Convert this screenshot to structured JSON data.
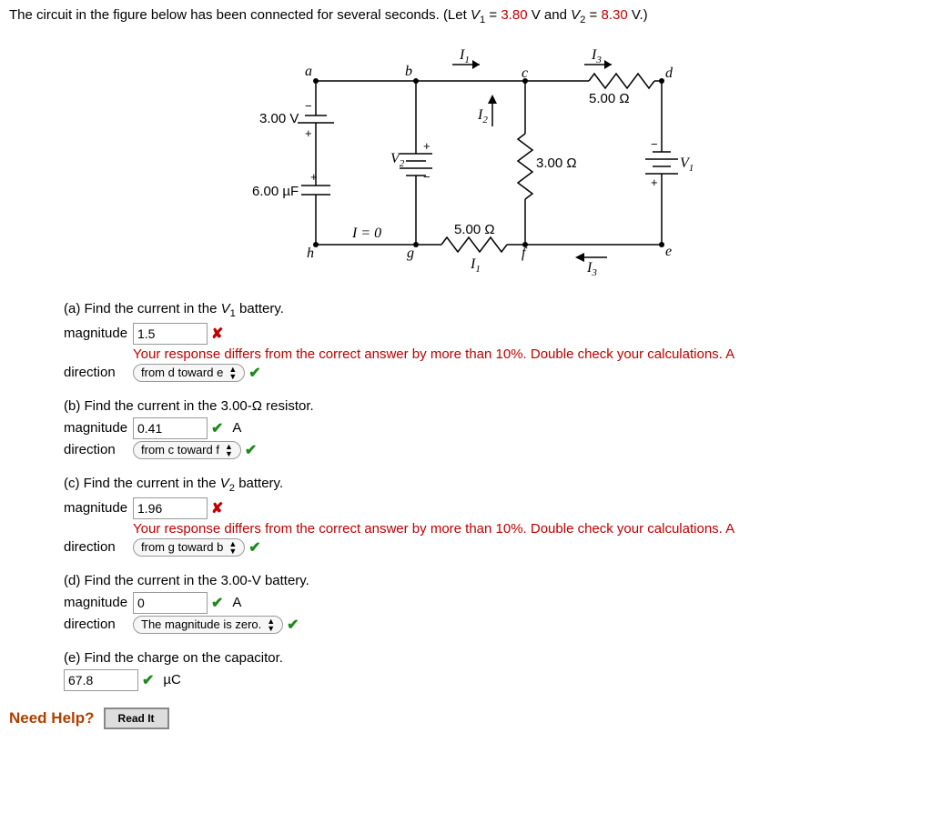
{
  "question_intro": {
    "pre": "The circuit in the figure below has been connected for several seconds. (Let ",
    "v1_label": "V",
    "v1_sub": "1",
    "eq1": " = ",
    "v1_val": "3.80",
    "v_unit": " V",
    "and": " and ",
    "v2_label": "V",
    "v2_sub": "2",
    "eq2": " = ",
    "v2_val": "8.30",
    "post": " V.)"
  },
  "feedback_msg": "Your response differs from the correct answer by more than 10%. Double check your calculations. A",
  "parts": {
    "a": {
      "label_pre": "(a) Find the current in the ",
      "label_post": " battery.",
      "mag_label": "magnitude",
      "mag_value": "1.5",
      "dir_label": "direction",
      "dir_value": "from d toward e"
    },
    "b": {
      "label": "(b) Find the current in the 3.00-Ω resistor.",
      "mag_label": "magnitude",
      "mag_value": "0.41",
      "mag_unit": "A",
      "dir_label": "direction",
      "dir_value": "from c toward f"
    },
    "c": {
      "label_pre": "(c) Find the current in the ",
      "label_post": " battery.",
      "mag_label": "magnitude",
      "mag_value": "1.96",
      "dir_label": "direction",
      "dir_value": "from g toward b"
    },
    "d": {
      "label": "(d) Find the current in the 3.00-V battery.",
      "mag_label": "magnitude",
      "mag_value": "0",
      "mag_unit": "A",
      "dir_label": "direction",
      "dir_value": "The magnitude is zero."
    },
    "e": {
      "label": "(e) Find the charge on the capacitor.",
      "value": "67.8",
      "unit": "µC"
    }
  },
  "need_help": "Need Help?",
  "read_it": "Read It",
  "diagram_labels": {
    "node_a": "a",
    "node_b": "b",
    "node_c": "c",
    "node_d": "d",
    "node_e": "e",
    "node_f": "f",
    "node_g": "g",
    "node_h": "h",
    "I1": "I",
    "I1_sub": "1",
    "I2": "I",
    "I2_sub": "2",
    "I3": "I",
    "I3_sub": "3",
    "I0": "I = 0",
    "V1": "V",
    "V1_sub": "1",
    "V2": "V",
    "V2_sub": "2",
    "r_top": "5.00 Ω",
    "r_mid": "3.00 Ω",
    "r_bot": "5.00 Ω",
    "batt_left": "3.00 V",
    "cap": "6.00 µF"
  }
}
